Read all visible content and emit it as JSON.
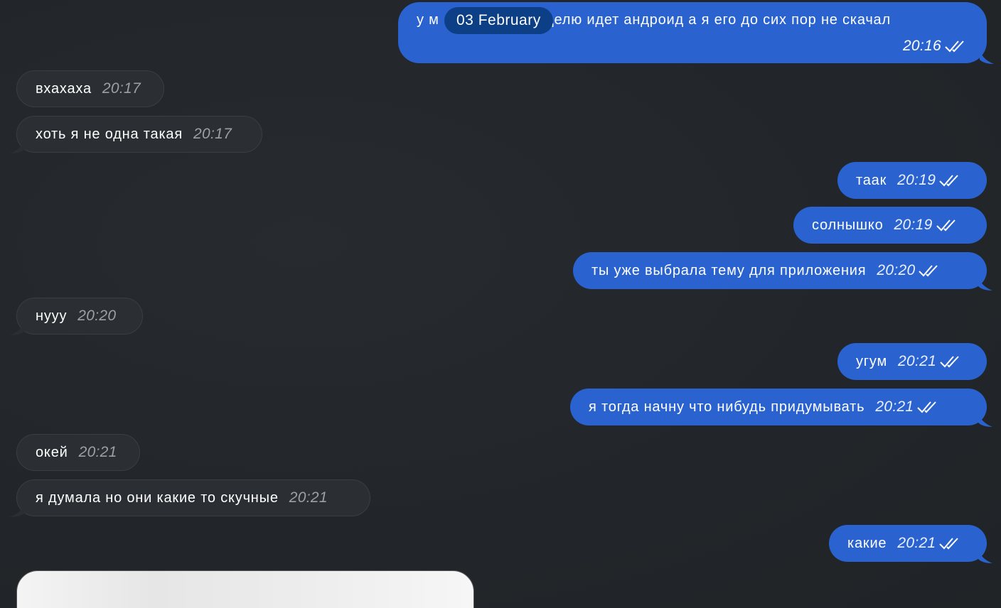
{
  "date_separator": "03 February",
  "messages": [
    {
      "dir": "out",
      "text": "у меня уже неделю идет андроид а я его до сих пор не скачал",
      "text_visible_start": "у м",
      "text_visible_end": "неделю идет андроид а я его до сих пор не скачал",
      "time": "20:16",
      "ticks": true
    },
    {
      "dir": "in",
      "text": "вхахаха",
      "time": "20:17"
    },
    {
      "dir": "in",
      "text": "хоть я не одна такая",
      "time": "20:17"
    },
    {
      "dir": "out",
      "text": "таак",
      "time": "20:19",
      "ticks": true
    },
    {
      "dir": "out",
      "text": "солнышко",
      "time": "20:19",
      "ticks": true
    },
    {
      "dir": "out",
      "text": "ты уже выбрала тему для приложения",
      "time": "20:20",
      "ticks": true
    },
    {
      "dir": "in",
      "text": "нууу",
      "time": "20:20"
    },
    {
      "dir": "out",
      "text": "угум",
      "time": "20:21",
      "ticks": true
    },
    {
      "dir": "out",
      "text": "я тогда начну что нибудь придумывать",
      "time": "20:21",
      "ticks": true
    },
    {
      "dir": "in",
      "text": "окей",
      "time": "20:21"
    },
    {
      "dir": "in",
      "text": "я думала но они какие то скучные",
      "time": "20:21"
    },
    {
      "dir": "out",
      "text": "какие",
      "time": "20:21",
      "ticks": true
    }
  ],
  "colors": {
    "background": "#23272b",
    "outgoing_bubble": "#2a63d0",
    "incoming_bubble": "#2b2f33",
    "date_pill": "#0d3f86"
  },
  "icons": {
    "read_receipt": "double-check-icon"
  }
}
